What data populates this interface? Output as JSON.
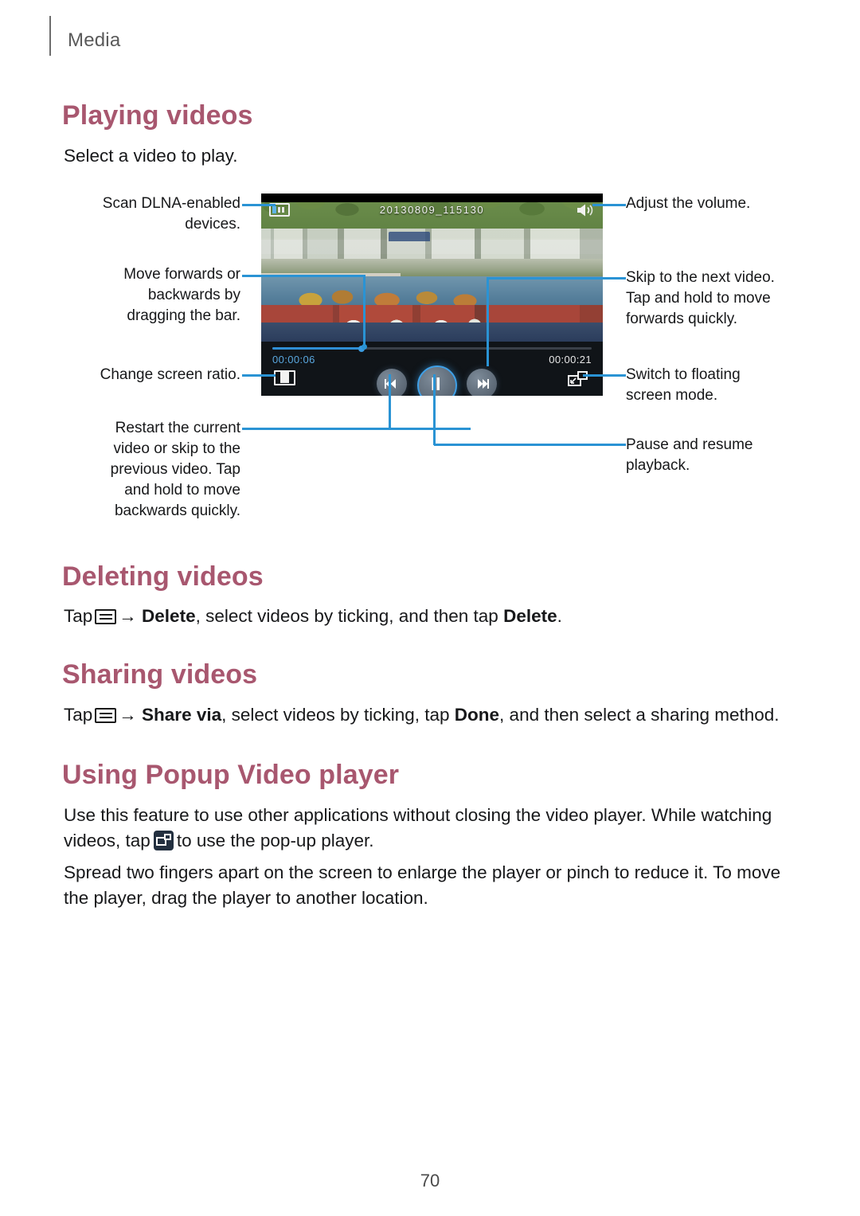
{
  "header": {
    "breadcrumb": "Media"
  },
  "sections": {
    "playing": {
      "heading": "Playing videos",
      "intro": "Select a video to play."
    },
    "deleting": {
      "heading": "Deleting videos",
      "line_part1": "Tap",
      "arrow": "→",
      "bold1": "Delete",
      "middle": ", select videos by ticking, and then tap",
      "bold2": "Delete",
      "end": "."
    },
    "sharing": {
      "heading": "Sharing videos",
      "line_part1": "Tap",
      "arrow": "→",
      "bold1": "Share via",
      "middle": ", select videos by ticking, tap",
      "bold2": "Done",
      "end": ", and then select a sharing method."
    },
    "popup": {
      "heading": "Using Popup Video player",
      "para1_a": "Use this feature to use other applications without closing the video player. While watching videos, tap",
      "para1_b": "to use the pop-up player.",
      "para2": "Spread two fingers apart on the screen to enlarge the player or pinch to reduce it. To move the player, drag the player to another location."
    }
  },
  "player": {
    "title": "20130809_115130",
    "time_current": "00:00:06",
    "time_total": "00:00:21",
    "progress_percent": 28,
    "icons": {
      "dlna": "dlna-scan-icon",
      "volume": "speaker-volume-icon",
      "screen_ratio": "screen-ratio-icon",
      "previous": "skip-previous-icon",
      "play_pause": "pause-icon",
      "next": "skip-next-icon",
      "popup": "popup-player-icon"
    }
  },
  "callouts": {
    "left": [
      {
        "id": "dlna",
        "text": "Scan DLNA-enabled devices."
      },
      {
        "id": "seek",
        "text": "Move forwards or backwards by dragging the bar."
      },
      {
        "id": "ratio",
        "text": "Change screen ratio."
      },
      {
        "id": "prev",
        "text": "Restart the current video or skip to the previous video. Tap and hold to move backwards quickly."
      }
    ],
    "right": [
      {
        "id": "volume",
        "text": "Adjust the volume."
      },
      {
        "id": "next",
        "text": "Skip to the next video. Tap and hold to move forwards quickly."
      },
      {
        "id": "popup",
        "text": "Switch to floating screen mode."
      },
      {
        "id": "pause",
        "text": "Pause and resume playback."
      }
    ]
  },
  "footer": {
    "page_number": "70"
  },
  "colors": {
    "heading": "#a8576f",
    "callout_line": "#2a93d4",
    "accent_blue": "#2f8fd6"
  }
}
